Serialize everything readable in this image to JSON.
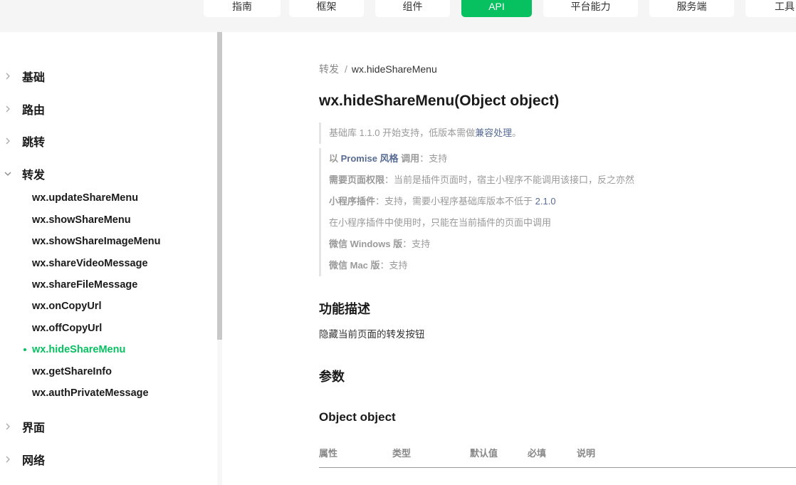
{
  "top_tabs": [
    {
      "label": "指南",
      "active": false
    },
    {
      "label": "框架",
      "active": false
    },
    {
      "label": "组件",
      "active": false
    },
    {
      "label": "API",
      "active": true
    },
    {
      "label": "平台能力",
      "active": false
    },
    {
      "label": "服务端",
      "active": false
    },
    {
      "label": "工具",
      "active": false
    }
  ],
  "sidebar": {
    "categories": [
      {
        "label": "基础",
        "expanded": false
      },
      {
        "label": "路由",
        "expanded": false
      },
      {
        "label": "跳转",
        "expanded": false
      },
      {
        "label": "转发",
        "expanded": true
      },
      {
        "label": "界面",
        "expanded": false
      },
      {
        "label": "网络",
        "expanded": false
      }
    ],
    "share_items": [
      "wx.updateShareMenu",
      "wx.showShareMenu",
      "wx.showShareImageMenu",
      "wx.shareVideoMessage",
      "wx.shareFileMessage",
      "wx.onCopyUrl",
      "wx.offCopyUrl",
      "wx.hideShareMenu",
      "wx.getShareInfo",
      "wx.authPrivateMessage"
    ],
    "active_item": "wx.hideShareMenu"
  },
  "breadcrumb": {
    "parent": "转发",
    "separator": "/",
    "current": "wx.hideShareMenu"
  },
  "page_title": "wx.hideShareMenu(Object object)",
  "support_note": {
    "prefix": "基础库 1.1.0 开始支持，低版本需做",
    "link": "兼容处理",
    "suffix": "。"
  },
  "meta": {
    "promise": {
      "pre": "以 ",
      "link": "Promise 风格",
      "post": " 调用",
      "colon": "：",
      "value": "支持"
    },
    "permission": {
      "label": "需要页面权限",
      "colon": "：",
      "value": "当前是插件页面时，宿主小程序不能调用该接口，反之亦然"
    },
    "plugin": {
      "label": "小程序插件",
      "colon": "：",
      "value": "支持，需要小程序基础库版本不低于 ",
      "version": "2.1.0"
    },
    "plugin_note": "在小程序插件中使用时，只能在当前插件的页面中调用",
    "windows": {
      "label": "微信 Windows 版",
      "colon": "：",
      "value": "支持"
    },
    "mac": {
      "label": "微信 Mac 版",
      "colon": "：",
      "value": "支持"
    }
  },
  "section_desc": {
    "heading": "功能描述",
    "text": "隐藏当前页面的转发按钮"
  },
  "section_params": {
    "heading": "参数",
    "object_heading": "Object object"
  },
  "table": {
    "headers": [
      "属性",
      "类型",
      "默认值",
      "必填",
      "说明"
    ]
  },
  "colors": {
    "accent": "#07c160",
    "link": "#576b95"
  }
}
